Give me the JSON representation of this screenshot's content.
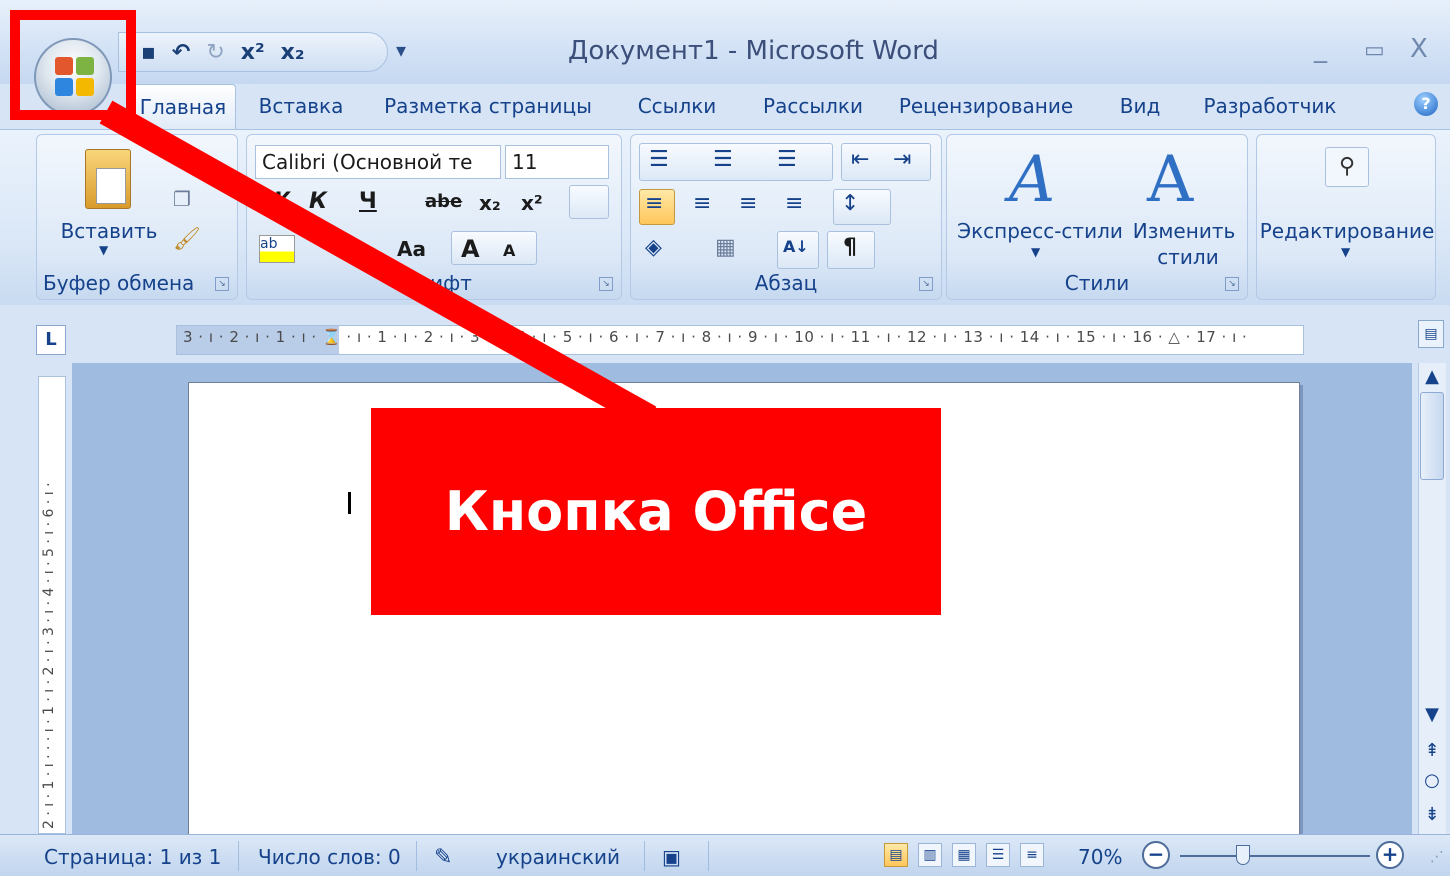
{
  "window": {
    "title": "Документ1 - Microsoft Word",
    "controls": {
      "minimize": "_",
      "maximize": "▭",
      "close": "X"
    }
  },
  "quick_access": {
    "save_icon": "save-icon",
    "undo": "↶",
    "redo": "↻",
    "superscript": "x²",
    "subscript": "x₂",
    "more": "▾"
  },
  "tabs": [
    {
      "label": "Главная",
      "active": true
    },
    {
      "label": "Вставка",
      "active": false
    },
    {
      "label": "Разметка страницы",
      "active": false
    },
    {
      "label": "Ссылки",
      "active": false
    },
    {
      "label": "Рассылки",
      "active": false
    },
    {
      "label": "Рецензирование",
      "active": false
    },
    {
      "label": "Вид",
      "active": false
    },
    {
      "label": "Разработчик",
      "active": false
    }
  ],
  "ribbon": {
    "clipboard": {
      "paste_label": "Вставить",
      "group_label": "Буфер обмена"
    },
    "font": {
      "font_name": "Calibri (Основной те",
      "font_size": "11",
      "bold": "Ж",
      "italic": "К",
      "underline": "Ч",
      "strike": "abe",
      "subscript": "x₂",
      "superscript": "x²",
      "case": "Aa",
      "grow": "A",
      "shrink": "A",
      "group_label": "Шрифт"
    },
    "paragraph": {
      "group_label": "Абзац",
      "sort": "А↓",
      "pilcrow": "¶"
    },
    "styles": {
      "express_label": "Экспресс-стили",
      "change_label_1": "Изменить",
      "change_label_2": "стили",
      "group_label": "Стили"
    },
    "editing": {
      "label": "Редактирование"
    }
  },
  "ruler": {
    "tab_selector": "L",
    "horizontal_text": "3 · ı · 2 · ı · 1 · ı · ⌛ · ı · 1 · ı · 2 · ı · 3 · ı · 4 · ı · 5 · ı · 6 · ı · 7 · ı · 8 · ı · 9 · ı · 10 · ı · 11 · ı · 12 · ı · 13 · ı · 14 · ı · 15 · ı · 16 · △ · 17 · ı ·",
    "vertical_text": "2 · ı · 1 · ı · · · ı · 1 · ı · 2 · ı · 3 · ı · 4 · ı · 5 · ı · 6 · ı ·"
  },
  "status": {
    "page": "Страница: 1 из 1",
    "words": "Число слов: 0",
    "language": "украинский",
    "zoom": "70%",
    "zoom_out": "−",
    "zoom_in": "+"
  },
  "annotation": {
    "callout_text": "Кнопка Office",
    "color": "#ff0000"
  }
}
